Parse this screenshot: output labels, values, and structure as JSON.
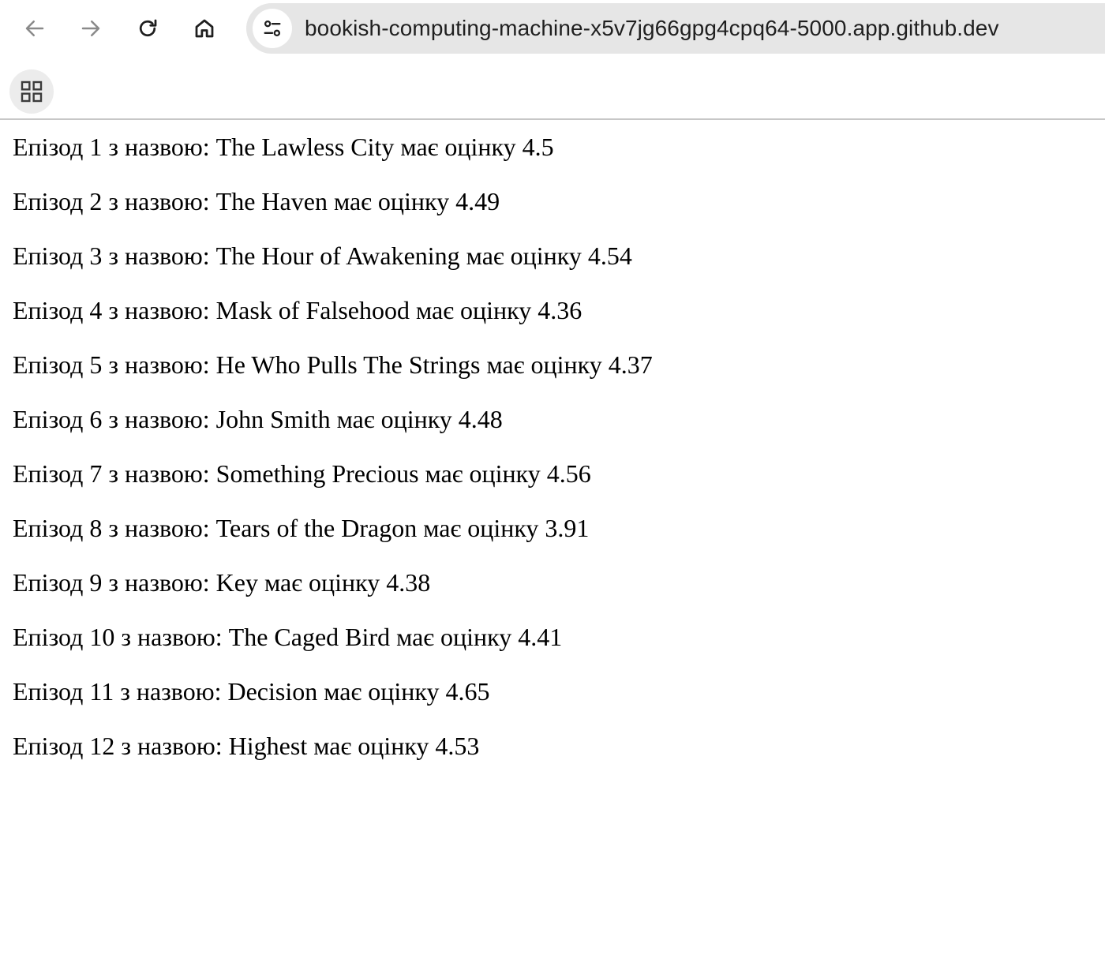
{
  "browser": {
    "url": "bookish-computing-machine-x5v7jg66gpg4cpq64-5000.app.github.dev",
    "icons": {
      "back": "arrow-left-icon",
      "forward": "arrow-right-icon",
      "reload": "reload-icon",
      "home": "home-icon",
      "site_info": "tune-icon",
      "apps": "apps-grid-icon"
    }
  },
  "episodes": [
    "Епізод 1 з назвою: The Lawless City має оцінку 4.5",
    "Епізод 2 з назвою: The Haven має оцінку 4.49",
    "Епізод 3 з назвою: The Hour of Awakening має оцінку 4.54",
    "Епізод 4 з назвою: Mask of Falsehood має оцінку 4.36",
    "Епізод 5 з назвою: He Who Pulls The Strings має оцінку 4.37",
    "Епізод 6 з назвою: John Smith має оцінку 4.48",
    "Епізод 7 з назвою: Something Precious має оцінку 4.56",
    "Епізод 8 з назвою: Tears of the Dragon має оцінку 3.91",
    "Епізод 9 з назвою: Key має оцінку 4.38",
    "Епізод 10 з назвою: The Caged Bird має оцінку 4.41",
    "Епізод 11 з назвою: Decision має оцінку 4.65",
    "Епізод 12 з назвою: Highest має оцінку 4.53"
  ]
}
